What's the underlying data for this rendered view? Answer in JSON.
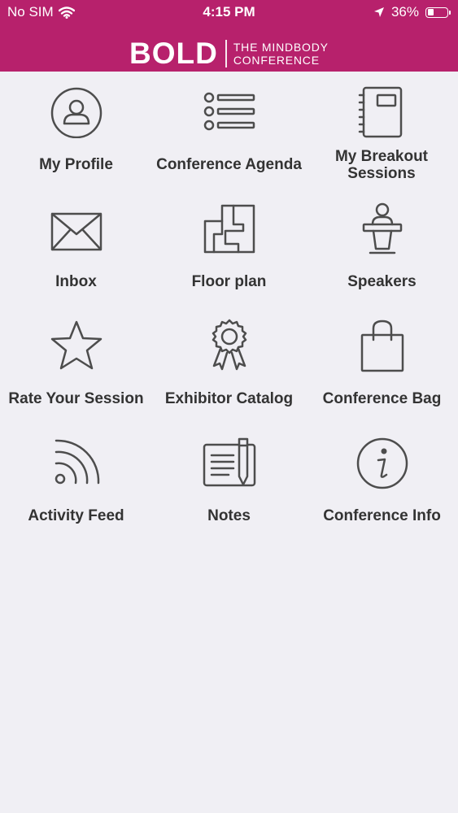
{
  "status_bar": {
    "carrier": "No SIM",
    "time": "4:15 PM",
    "battery": "36%",
    "battery_level": 0.36
  },
  "header": {
    "logo_main": "BOLD",
    "logo_line1": "THE MINDBODY",
    "logo_line2": "CONFERENCE",
    "background": "#b7216c"
  },
  "menu": [
    {
      "label": "My Profile",
      "icon": "profile-icon"
    },
    {
      "label": "Conference Agenda",
      "icon": "agenda-list-icon"
    },
    {
      "label": "My Breakout Sessions",
      "icon": "notebook-icon"
    },
    {
      "label": "Inbox",
      "icon": "envelope-icon"
    },
    {
      "label": "Floor plan",
      "icon": "floor-plan-icon"
    },
    {
      "label": "Speakers",
      "icon": "speaker-podium-icon"
    },
    {
      "label": "Rate Your Session",
      "icon": "star-icon"
    },
    {
      "label": "Exhibitor Catalog",
      "icon": "award-ribbon-icon"
    },
    {
      "label": "Conference Bag",
      "icon": "shopping-bag-icon"
    },
    {
      "label": "Activity Feed",
      "icon": "rss-feed-icon"
    },
    {
      "label": "Notes",
      "icon": "notes-pen-icon"
    },
    {
      "label": "Conference Info",
      "icon": "info-icon"
    }
  ]
}
